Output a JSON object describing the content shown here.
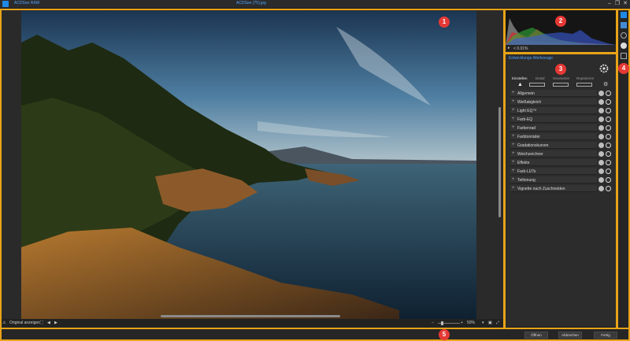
{
  "window": {
    "app_title": "ACDSee RAW",
    "file_title": "ACDSee (75).jpg"
  },
  "badges": [
    "1",
    "2",
    "3",
    "4",
    "5"
  ],
  "viewer": {
    "show_original_label": "Original anzeigen",
    "zoom_value": "50%"
  },
  "histogram": {
    "readout": "< 0.01%",
    "colors": {
      "red": "#d9262c",
      "green": "#2fae3a",
      "blue": "#3a5bd9"
    }
  },
  "tools": {
    "title": "Entwicklungs-Werkzeuge",
    "tabs": [
      "Einstellen",
      "Detail",
      "Geometrie",
      "Reparieren"
    ],
    "sections": [
      "Allgemein",
      "Weißabgleich",
      "Light EQ™",
      "Farb-EQ",
      "Farbenrad",
      "Farbtonräder",
      "Gradationskurven",
      "Weichzeichner",
      "Effekte",
      "Farb-LUTs",
      "Teiltonung",
      "Vignette nach Zuschneiden"
    ]
  },
  "footer": {
    "buttons": [
      "Öffnen",
      "Abbrechen",
      "Fertig"
    ]
  },
  "colors": {
    "accent": "#e8a317",
    "badge": "#e53935",
    "link": "#4fa3ff"
  }
}
